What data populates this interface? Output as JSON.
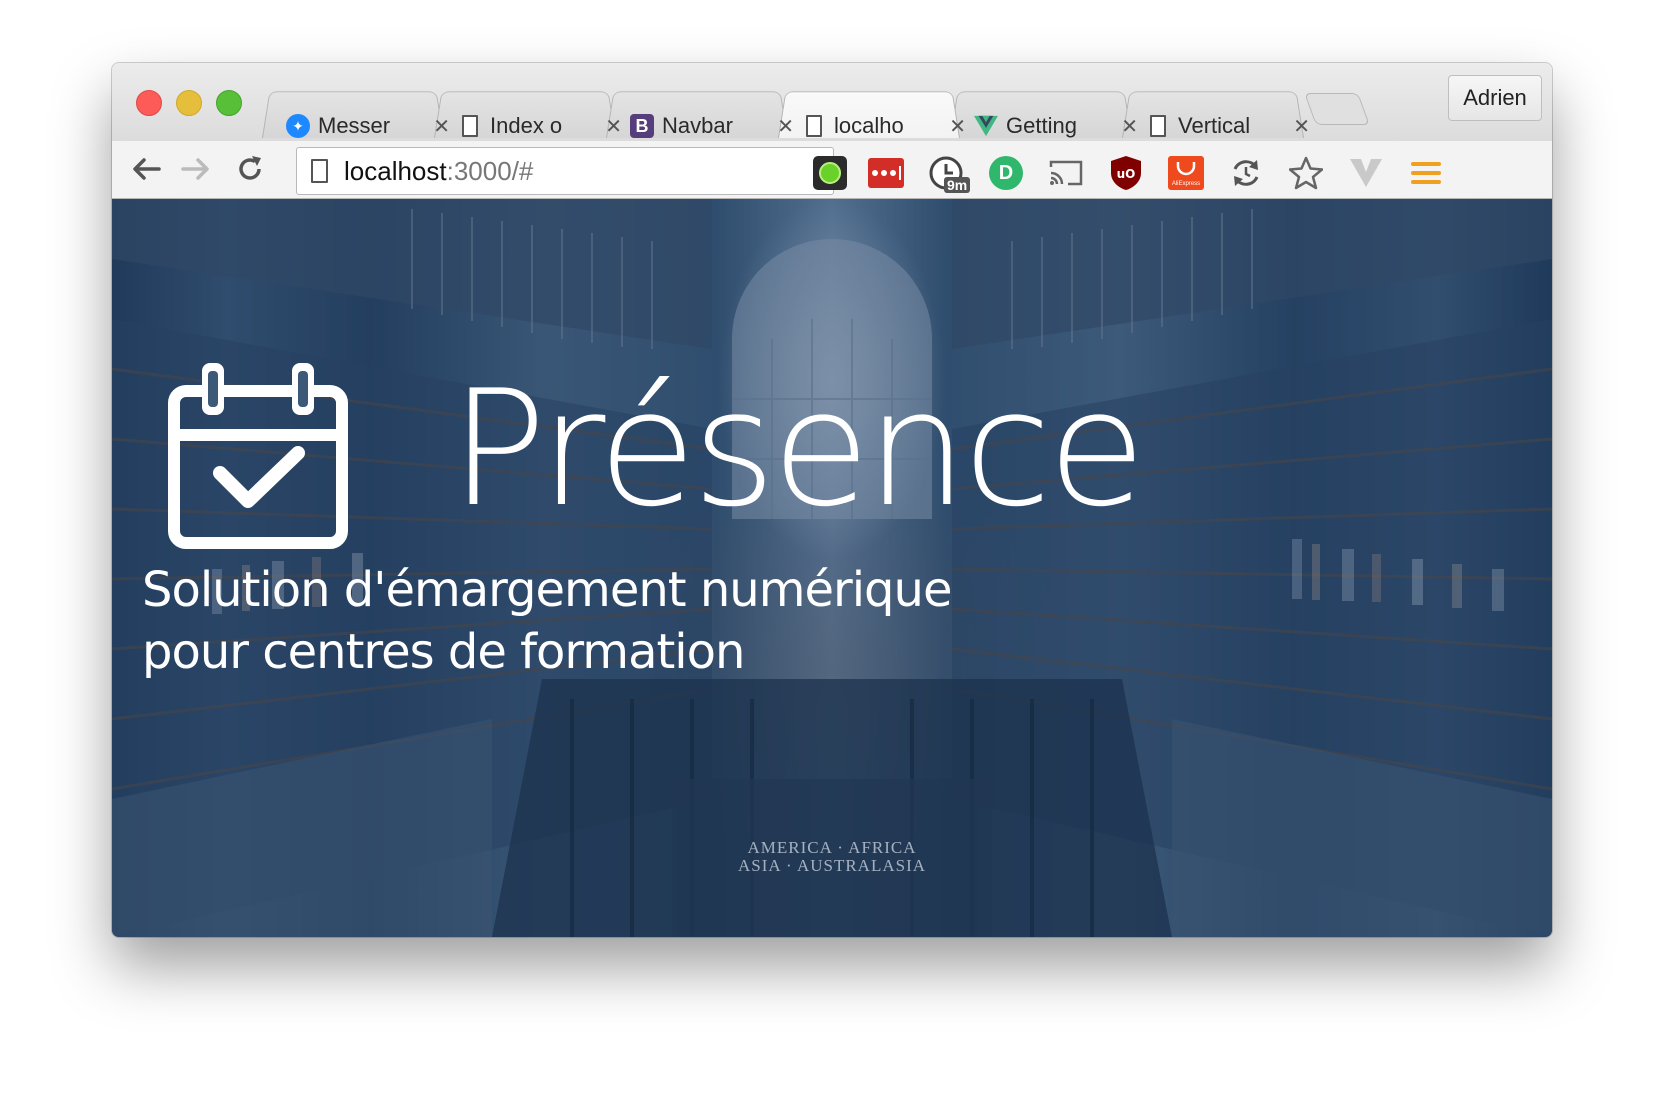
{
  "browser": {
    "tabs": [
      {
        "label": "Messer",
        "icon": "messenger-icon",
        "active": false
      },
      {
        "label": "Index o",
        "icon": "page-icon",
        "active": false
      },
      {
        "label": "Navbar",
        "icon": "bootstrap-icon",
        "active": false
      },
      {
        "label": "localho",
        "icon": "page-icon",
        "active": true
      },
      {
        "label": "Getting",
        "icon": "vue-icon",
        "active": false
      },
      {
        "label": "Vertical",
        "icon": "page-icon",
        "active": false
      }
    ],
    "profile_label": "Adrien",
    "favicon_b": "B",
    "tab_close_glyph": "✕",
    "address": {
      "host": "localhost",
      "path": ":3000/#"
    },
    "extensions": [
      {
        "name": "green-dot-extension-icon"
      },
      {
        "name": "lastpass-icon"
      },
      {
        "name": "timer-extension-icon",
        "badge": "9m"
      },
      {
        "name": "id-extension-icon"
      },
      {
        "name": "cast-icon"
      },
      {
        "name": "ublock-icon",
        "label": "uO"
      },
      {
        "name": "aliexpress-icon",
        "label": "AliExpress"
      },
      {
        "name": "sync-extension-icon"
      },
      {
        "name": "bookmark-star-icon"
      },
      {
        "name": "vimium-icon"
      },
      {
        "name": "menu-icon"
      }
    ]
  },
  "hero": {
    "title": "Présence",
    "subtitle_line1": "Solution d'émargement numérique",
    "subtitle_line2": "pour centres de formation",
    "floor_line1": "AMERICA · AFRICA",
    "floor_line2": "ASIA · AUSTRALASIA"
  },
  "colors": {
    "overlay": "#1e3c64",
    "close": "#fc5b57",
    "minimize": "#e5bf3c",
    "maximize": "#57c038"
  }
}
